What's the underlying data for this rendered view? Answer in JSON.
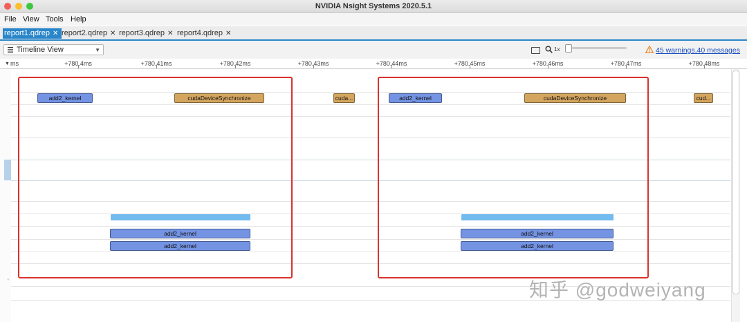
{
  "window": {
    "title": "NVIDIA Nsight Systems 2020.5.1",
    "traffic_light_colors": [
      "#f25f58",
      "#f9be2e",
      "#3bc840"
    ]
  },
  "menu": [
    "File",
    "View",
    "Tools",
    "Help"
  ],
  "tabs": [
    {
      "label": "report1.qdrep",
      "active": true
    },
    {
      "label": "report2.qdrep",
      "active": false
    },
    {
      "label": "report3.qdrep",
      "active": false
    },
    {
      "label": "report4.qdrep",
      "active": false
    }
  ],
  "tab_close_glyph": "✕",
  "toolbar": {
    "view_selector": "Timeline View",
    "zoom_label": "1x",
    "warnings_link": "45 warnings,40 messages"
  },
  "ruler": {
    "leading_label": "ms",
    "labels": [
      "+780.4ms",
      "+780.41ms",
      "+780.42ms",
      "+780.43ms",
      "+780.44ms",
      "+780.45ms",
      "+780.46ms",
      "+780.47ms",
      "+780.48ms"
    ]
  },
  "timeline": {
    "blocks": [
      {
        "label": "add2_kernel",
        "kind": "kernel"
      },
      {
        "label": "cudaDeviceSynchronize",
        "kind": "sync"
      },
      {
        "label": "cuda...",
        "kind": "sync"
      },
      {
        "label": "add2_kernel",
        "kind": "kernel"
      },
      {
        "label": "cudaDeviceSynchronize",
        "kind": "sync"
      },
      {
        "label": "cud...",
        "kind": "sync"
      },
      {
        "label": "",
        "kind": "mem"
      },
      {
        "label": "add2_kernel",
        "kind": "kernel"
      },
      {
        "label": "add2_kernel",
        "kind": "kernel"
      },
      {
        "label": "",
        "kind": "mem"
      },
      {
        "label": "add2_kernel",
        "kind": "kernel"
      },
      {
        "label": "add2_kernel",
        "kind": "kernel"
      }
    ]
  },
  "watermark": "知乎 @godweiyang",
  "colors": {
    "accent": "#2a86c9",
    "kernel": "#7493e3",
    "sync": "#d4a55f",
    "memcpy": "#72bbef",
    "selection": "#d9322b",
    "warning_link": "#1a4fbf"
  }
}
